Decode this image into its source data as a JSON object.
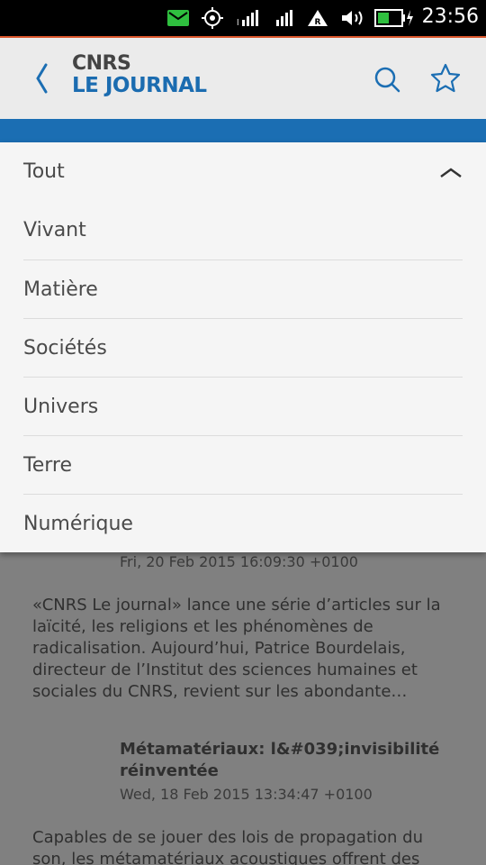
{
  "status_bar": {
    "time": "23:56",
    "icons": [
      "message-icon",
      "location-icon",
      "signal-icon",
      "signal-icon",
      "roaming-icon",
      "volume-icon",
      "battery-charging-icon"
    ]
  },
  "header": {
    "logo_line1": "CNRS",
    "logo_line2": "LE JOURNAL",
    "back_icon": "chevron-left-icon",
    "search_icon": "search-icon",
    "favorite_icon": "star-icon"
  },
  "colors": {
    "brand_blue": "#1b6eb3",
    "header_bg": "#ebebeb",
    "accent_orange": "#d8542a",
    "status_green": "#2fbf3f"
  },
  "categories": {
    "selected": "Tout",
    "items": [
      "Vivant",
      "Matière",
      "Sociétés",
      "Univers",
      "Terre",
      "Numérique"
    ]
  },
  "articles": [
    {
      "date": "Fri, 20 Feb 2015 16:09:30 +0100",
      "summary": "«CNRS Le journal» lance une série d’articles sur la laïcité, les religions et les phénomènes de radicalisation. Aujourd’hui, Patrice Bourdelais, directeur de l’Institut des sciences humaines et sociales du CNRS, revient sur les abondante…"
    },
    {
      "title": "Métamatériaux: l&#039;invisibilité réinventée",
      "date": "Wed, 18 Feb 2015 13:34:47 +0100",
      "summary": "Capables de se jouer des lois de propagation du son, les métamatériaux acoustiques offrent des"
    }
  ]
}
